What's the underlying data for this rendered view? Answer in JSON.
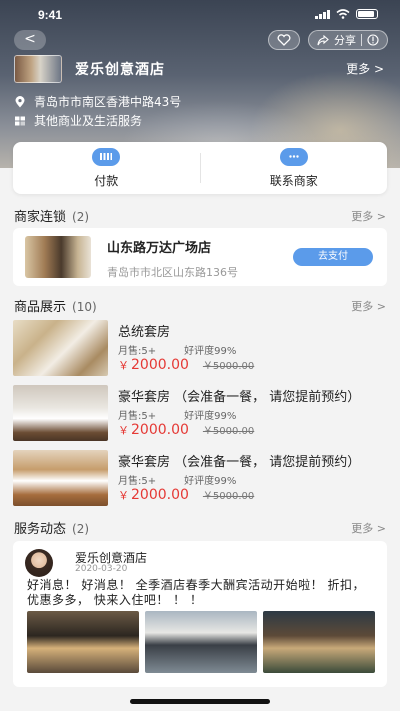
{
  "status": {
    "time": "9:41"
  },
  "header": {
    "store_name": "爱乐创意酒店",
    "more_label": "更多 >",
    "share_label": "分享",
    "address": "青岛市市南区香港中路43号",
    "category": "其他商业及生活服务"
  },
  "actions": {
    "pay_label": "付款",
    "contact_label": "联系商家"
  },
  "chain": {
    "title": "商家连锁",
    "count": "(2)",
    "more": "更多 >",
    "store": {
      "name": "山东路万达广场店",
      "address": "青岛市市北区山东路136号",
      "pay_button": "去支付"
    }
  },
  "products": {
    "title": "商品展示",
    "count": "(10)",
    "more": "更多 >",
    "items": [
      {
        "name": "总统套房",
        "sold": "月售:5+",
        "rating": "好评度99%",
        "currency": "￥",
        "price": "2000.00",
        "old_price": "￥5000.00"
      },
      {
        "name": "豪华套房 （会准备一餐， 请您提前预约）",
        "sold": "月售:5+",
        "rating": "好评度99%",
        "currency": "￥",
        "price": "2000.00",
        "old_price": "￥5000.00"
      },
      {
        "name": "豪华套房 （会准备一餐， 请您提前预约）",
        "sold": "月售:5+",
        "rating": "好评度99%",
        "currency": "￥",
        "price": "2000.00",
        "old_price": "￥5000.00"
      }
    ]
  },
  "feed": {
    "title": "服务动态",
    "count": "(2)",
    "more": "更多 >",
    "post": {
      "author": "爱乐创意酒店",
      "date": "2020-03-20",
      "text": "好消息！ 好消息！ 全季酒店春季大酬宾活动开始啦！ 折扣， 优惠多多， 快来入住吧！ ！ ！"
    }
  },
  "colors": {
    "accent": "#5b9bea",
    "price": "#e53935"
  }
}
